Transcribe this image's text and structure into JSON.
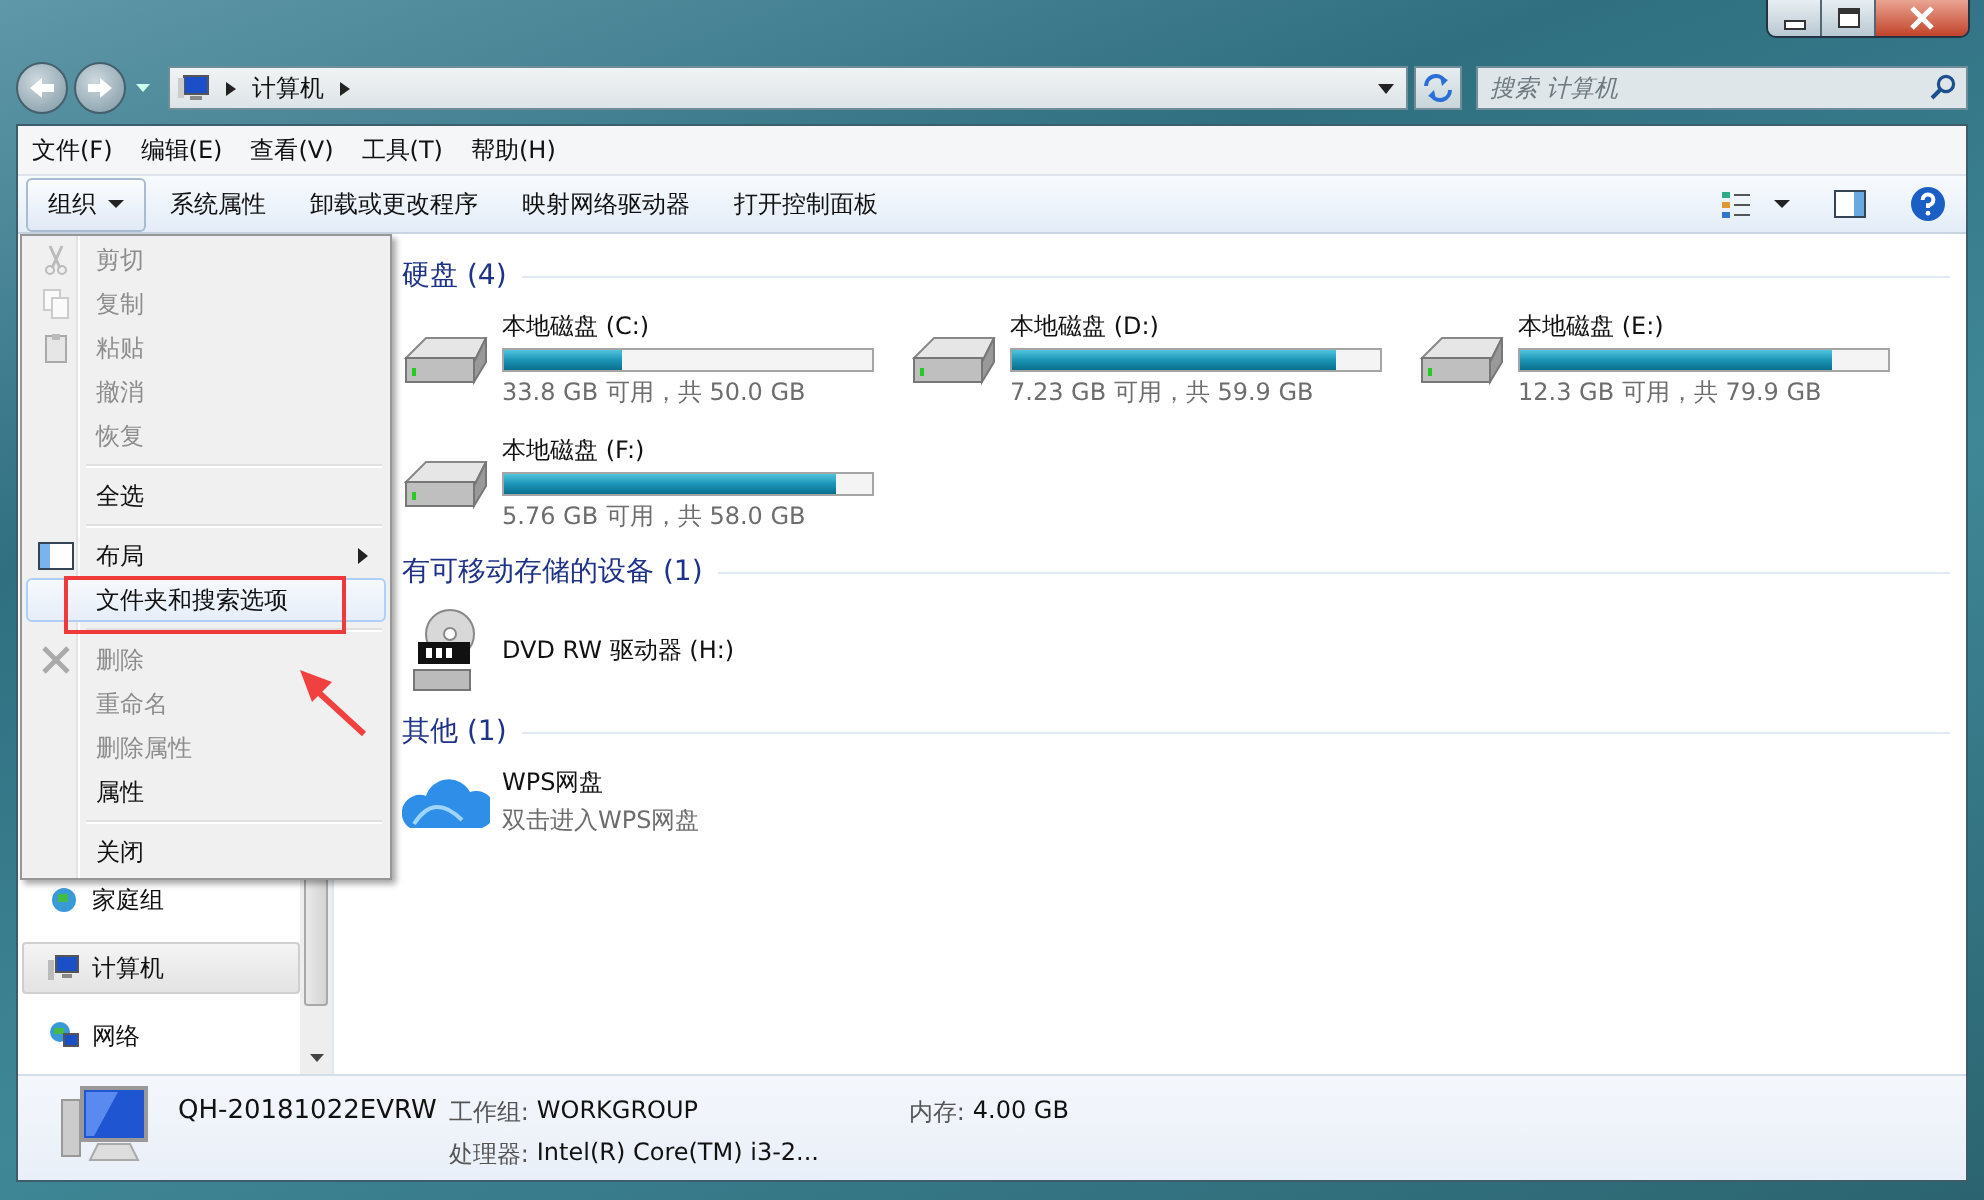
{
  "address_bar": {
    "path": [
      "计算机"
    ]
  },
  "search": {
    "placeholder": "搜索 计算机"
  },
  "menu_bar": [
    "文件(F)",
    "编辑(E)",
    "查看(V)",
    "工具(T)",
    "帮助(H)"
  ],
  "toolbar": {
    "buttons": [
      {
        "label": "组织",
        "kind": "dropdown"
      },
      {
        "label": "系统属性",
        "kind": "plain"
      },
      {
        "label": "卸载或更改程序",
        "kind": "plain"
      },
      {
        "label": "映射网络驱动器",
        "kind": "plain"
      },
      {
        "label": "打开控制面板",
        "kind": "plain"
      }
    ]
  },
  "context_menu": {
    "groups": [
      [
        {
          "label": "剪切",
          "kind": "cut",
          "disabled": true,
          "selected": false,
          "has_submenu": false
        },
        {
          "label": "复制",
          "kind": "copy",
          "disabled": true,
          "selected": false,
          "has_submenu": false
        },
        {
          "label": "粘贴",
          "kind": "paste",
          "disabled": true,
          "selected": false,
          "has_submenu": false
        },
        {
          "label": "撤消",
          "kind": "plain",
          "disabled": true,
          "selected": false,
          "has_submenu": false
        },
        {
          "label": "恢复",
          "kind": "plain",
          "disabled": true,
          "selected": false,
          "has_submenu": false
        }
      ],
      [
        {
          "label": "全选",
          "kind": "plain",
          "disabled": false,
          "selected": false,
          "has_submenu": false
        }
      ],
      [
        {
          "label": "布局",
          "kind": "layout",
          "disabled": false,
          "selected": false,
          "has_submenu": true
        },
        {
          "label": "文件夹和搜索选项",
          "kind": "plain",
          "disabled": false,
          "selected": true,
          "has_submenu": false
        }
      ],
      [
        {
          "label": "删除",
          "kind": "delete",
          "disabled": true,
          "selected": false,
          "has_submenu": false
        },
        {
          "label": "重命名",
          "kind": "plain",
          "disabled": true,
          "selected": false,
          "has_submenu": false
        },
        {
          "label": "删除属性",
          "kind": "plain",
          "disabled": true,
          "selected": false,
          "has_submenu": false
        },
        {
          "label": "属性",
          "kind": "plain",
          "disabled": false,
          "selected": false,
          "has_submenu": false
        }
      ],
      [
        {
          "label": "关闭",
          "kind": "plain",
          "disabled": false,
          "selected": false,
          "has_submenu": false
        }
      ]
    ]
  },
  "navigation": [
    {
      "label": "家庭组",
      "kind": "homegroup",
      "selected": false
    },
    {
      "label": "计算机",
      "kind": "computer",
      "selected": true
    },
    {
      "label": "网络",
      "kind": "network",
      "selected": false
    }
  ],
  "sections": [
    {
      "title": "硬盘 (4)",
      "items": [
        {
          "kind": "drive",
          "name": "本地磁盘 (C:)",
          "level": 0.32,
          "info": "33.8 GB 可用，共 50.0 GB"
        },
        {
          "kind": "drive",
          "name": "本地磁盘 (D:)",
          "level": 0.88,
          "info": "7.23 GB 可用，共 59.9 GB"
        },
        {
          "kind": "drive",
          "name": "本地磁盘 (E:)",
          "level": 0.85,
          "info": "12.3 GB 可用，共 79.9 GB"
        },
        {
          "kind": "drive",
          "name": "本地磁盘 (F:)",
          "level": 0.9,
          "info": "5.76 GB 可用，共 58.0 GB"
        }
      ]
    },
    {
      "title": "有可移动存储的设备 (1)",
      "items": [
        {
          "kind": "dvd",
          "name": "DVD RW 驱动器 (H:)"
        }
      ]
    },
    {
      "title": "其他 (1)",
      "items": [
        {
          "kind": "cloud",
          "name": "WPS网盘",
          "info": "双击进入WPS网盘"
        }
      ]
    }
  ],
  "details": {
    "name": "QH-20181022EVRW",
    "fields": [
      {
        "label": "工作组:",
        "value": "WORKGROUP"
      },
      {
        "label": "内存:",
        "value": "4.00 GB"
      },
      {
        "label": "处理器:",
        "value": "Intel(R) Core(TM) i3-2..."
      }
    ]
  }
}
